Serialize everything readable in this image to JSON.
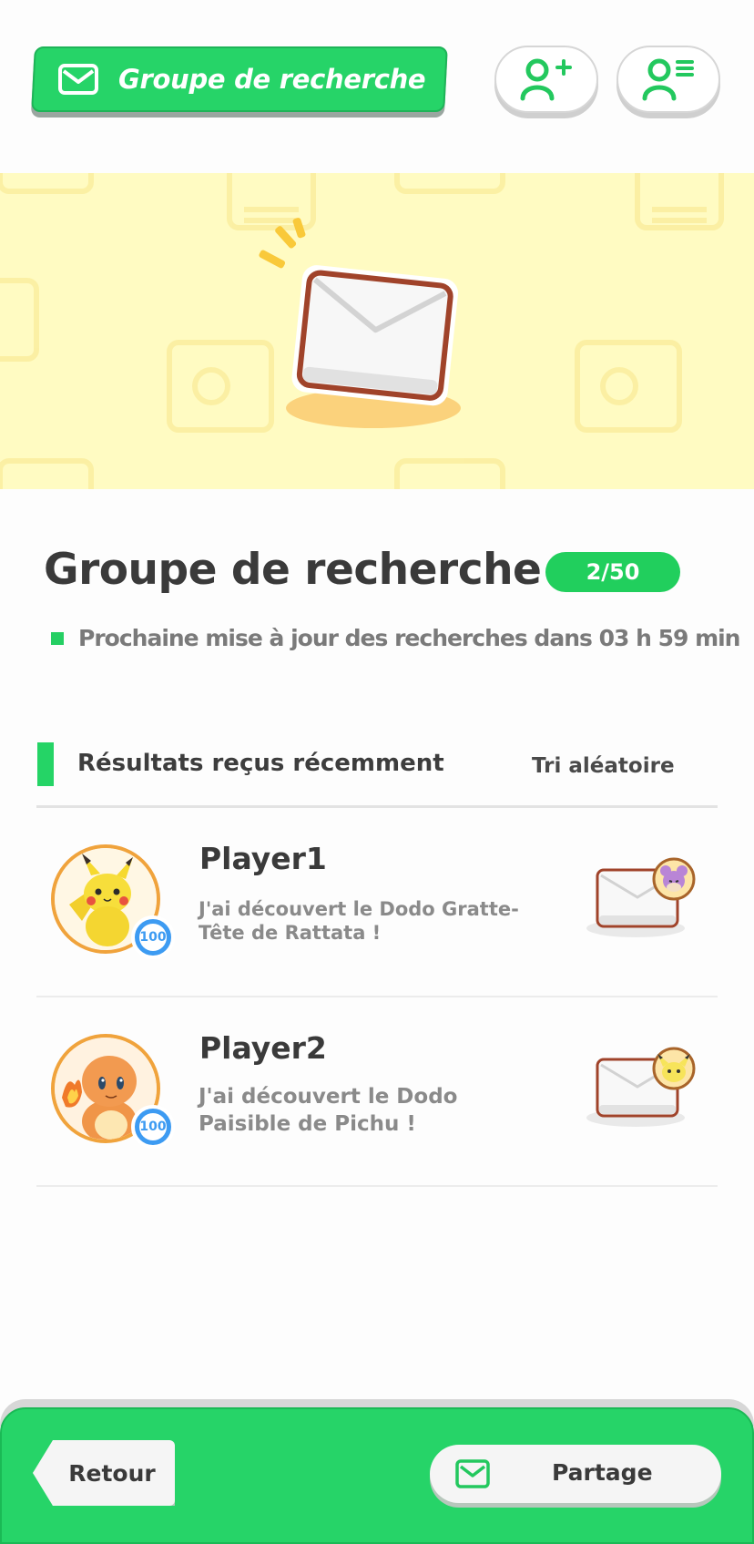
{
  "header": {
    "title": "Groupe de recherche",
    "icons": [
      "mail-icon",
      "add-friend-icon",
      "friend-list-icon"
    ]
  },
  "banner": {
    "illustration": "envelope-illustration"
  },
  "main": {
    "title": "Groupe de recherche",
    "count": "2/50",
    "update_text": "Prochaine mise à jour des recherches dans 03 h 59 min"
  },
  "results": {
    "section_title": "Résultats reçus récemment",
    "sort_label": "Tri aléatoire",
    "items": [
      {
        "player": "Player1",
        "message": "J'ai découvert le Dodo Gratte-Tête de Rattata !",
        "level": "100",
        "avatar": "pikachu-avatar",
        "pokemon_icon": "rattata-icon"
      },
      {
        "player": "Player2",
        "message": "J'ai découvert le Dodo Paisible de Pichu !",
        "level": "100",
        "avatar": "charmander-avatar",
        "pokemon_icon": "pichu-icon"
      }
    ]
  },
  "footer": {
    "back_label": "Retour",
    "share_label": "Partage"
  },
  "colors": {
    "accent_green": "#26d468",
    "banner_yellow": "#fffbc2",
    "level_blue": "#3d9bf2",
    "envelope_border": "#a0432a"
  }
}
